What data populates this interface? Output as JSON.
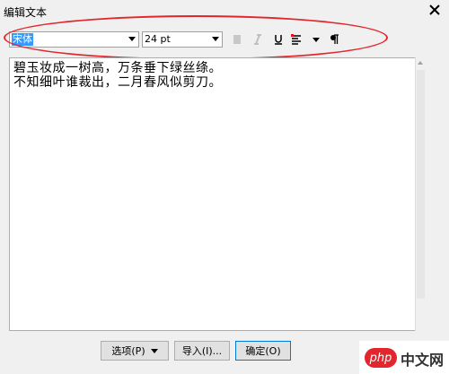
{
  "window": {
    "title": "编辑文本"
  },
  "toolbar": {
    "font_name": "宋体",
    "font_size": "24 pt"
  },
  "editor": {
    "line1": "碧玉妆成一树高，万条垂下绿丝绦。",
    "line2": "不知细叶谁裁出，二月春风似剪刀。"
  },
  "buttons": {
    "options": "选项(P)",
    "import": "导入(I)...",
    "ok": "确定(O)"
  },
  "watermark": {
    "brand": "php",
    "text": "中文网"
  },
  "colors": {
    "annotation": "#e3262c",
    "selection": "#3399ff",
    "accent": "#0078d7"
  }
}
